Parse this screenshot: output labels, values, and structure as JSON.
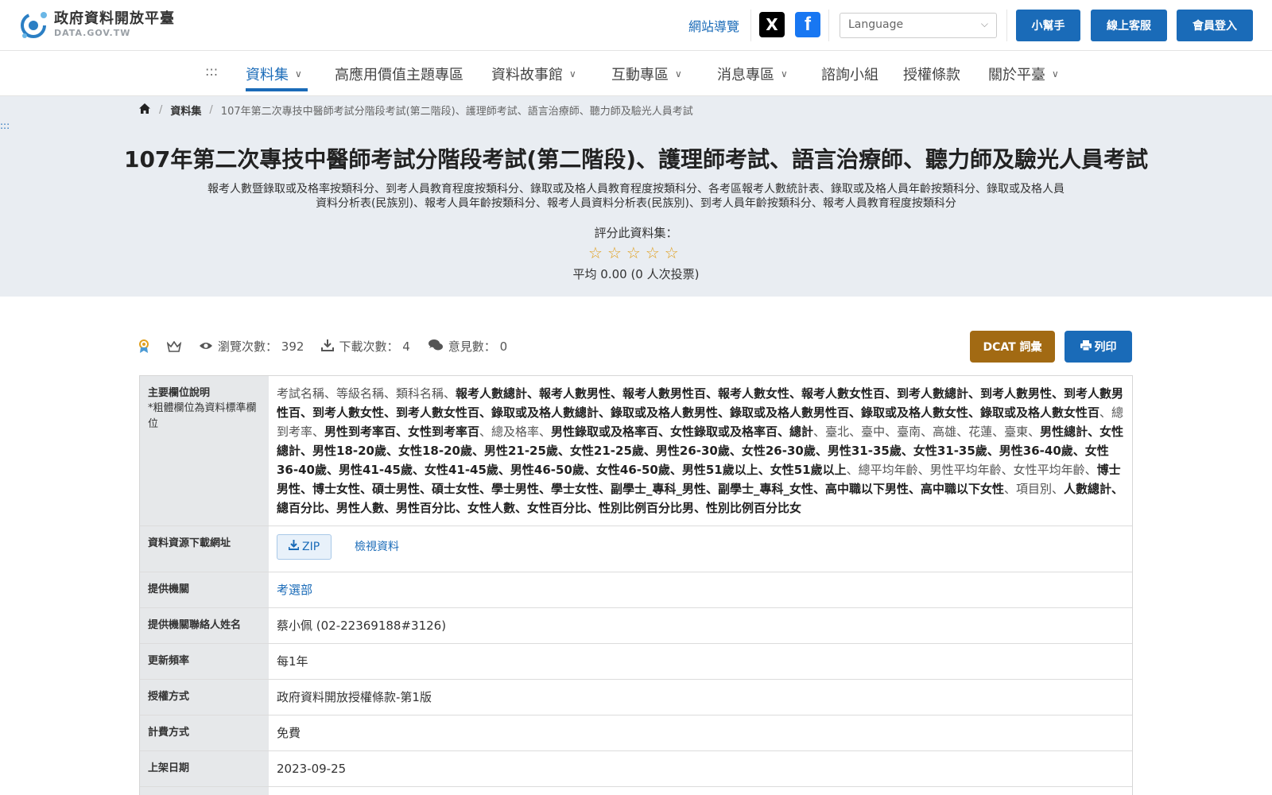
{
  "header": {
    "logo_title": "政府資料開放平臺",
    "logo_sub": "DATA.GOV.TW",
    "sitemap": "網站導覽",
    "social_x": "X",
    "social_fb": "f",
    "language_placeholder": "Language",
    "btn_helper": "小幫手",
    "btn_service": "線上客服",
    "btn_login": "會員登入"
  },
  "nav": {
    "skip": ":::",
    "items": [
      "資料集",
      "高應用價值主題專區",
      "資料故事館",
      "互動專區",
      "消息專區",
      "諮詢小組",
      "授權條款",
      "關於平臺"
    ]
  },
  "breadcrumb": {
    "level1": "資料集",
    "current": "107年第二次專技中醫師考試分階段考試(第二階段)、護理師考試、語言治療師、聽力師及驗光人員考試"
  },
  "hero": {
    "skip": ":::",
    "title": "107年第二次專技中醫師考試分階段考試(第二階段)、護理師考試、語言治療師、聽力師及驗光人員考試",
    "description": "報考人數暨錄取或及格率按類科分、到考人員教育程度按類科分、錄取或及格人員教育程度按類科分、各考區報考人數統計表、錄取或及格人員年齡按類科分、錄取或及格人員資料分析表(民族別)、報考人員年齡按類科分、報考人員資料分析表(民族別)、到考人員年齡按類科分、報考人員教育程度按類科分",
    "rate_label": "評分此資料集：",
    "rating": 0,
    "rate_avg": "平均 0.00 (0 人次投票)"
  },
  "stats": {
    "views_label": "瀏覽次數：",
    "views": "392",
    "downloads_label": "下載次數：",
    "downloads": "4",
    "comments_label": "意見數：",
    "comments": "0",
    "btn_dcat": "DCAT 詞彙",
    "btn_print": "列印"
  },
  "table": {
    "fields_label": "主要欄位說明",
    "fields_note": "*粗體欄位為資料標準欄位",
    "fields_segments": [
      {
        "t": "考試名稱、等級名稱、類科名稱、",
        "b": false
      },
      {
        "t": "報考人數總計、報考人數男性、報考人數男性百、報考人數女性、報考人數女性百、到考人數總計、到考人數男性、到考人數男性百、到考人數女性、到考人數女性百、錄取或及格人數總計、錄取或及格人數男性、錄取或及格人數男性百、錄取或及格人數女性、錄取或及格人數女性百",
        "b": true
      },
      {
        "t": "、總到考率、",
        "b": false
      },
      {
        "t": "男性到考率百、女性到考率百",
        "b": true
      },
      {
        "t": "、總及格率、",
        "b": false
      },
      {
        "t": "男性錄取或及格率百、女性錄取或及格率百、總計",
        "b": true
      },
      {
        "t": "、臺北、臺中、臺南、高雄、花蓮、臺東、",
        "b": false
      },
      {
        "t": "男性總計、女性總計、男性18-20歲、女性18-20歲、男性21-25歲、女性21-25歲、男性26-30歲、女性26-30歲、男性31-35歲、女性31-35歲、男性36-40歲、女性36-40歲、男性41-45歲、女性41-45歲、男性46-50歲、女性46-50歲、男性51歲以上、女性51歲以上",
        "b": true
      },
      {
        "t": "、總平均年齡、男性平均年齡、女性平均年齡、",
        "b": false
      },
      {
        "t": "博士男性、博士女性、碩士男性、碩士女性、學士男性、學士女性、副學士_專科_男性、副學士_專科_女性、高中職以下男性、高中職以下女性",
        "b": true
      },
      {
        "t": "、項目別、",
        "b": false
      },
      {
        "t": "人數總計、總百分比、男性人數、男性百分比、女性人數、女性百分比、性別比例百分比男、性別比例百分比女",
        "b": true
      }
    ],
    "download_label": "資料資源下載網址",
    "zip_label": "ZIP",
    "view_label": "檢視資料",
    "provider_label": "提供機關",
    "provider": "考選部",
    "contact_label": "提供機關聯絡人姓名",
    "contact": "蔡小佩 (02-22369188#3126)",
    "frequency_label": "更新頻率",
    "frequency": "每1年",
    "license_label": "授權方式",
    "license": "政府資料開放授權條款-第1版",
    "fee_label": "計費方式",
    "fee": "免費",
    "published_label": "上架日期",
    "published": "2023-09-25"
  }
}
